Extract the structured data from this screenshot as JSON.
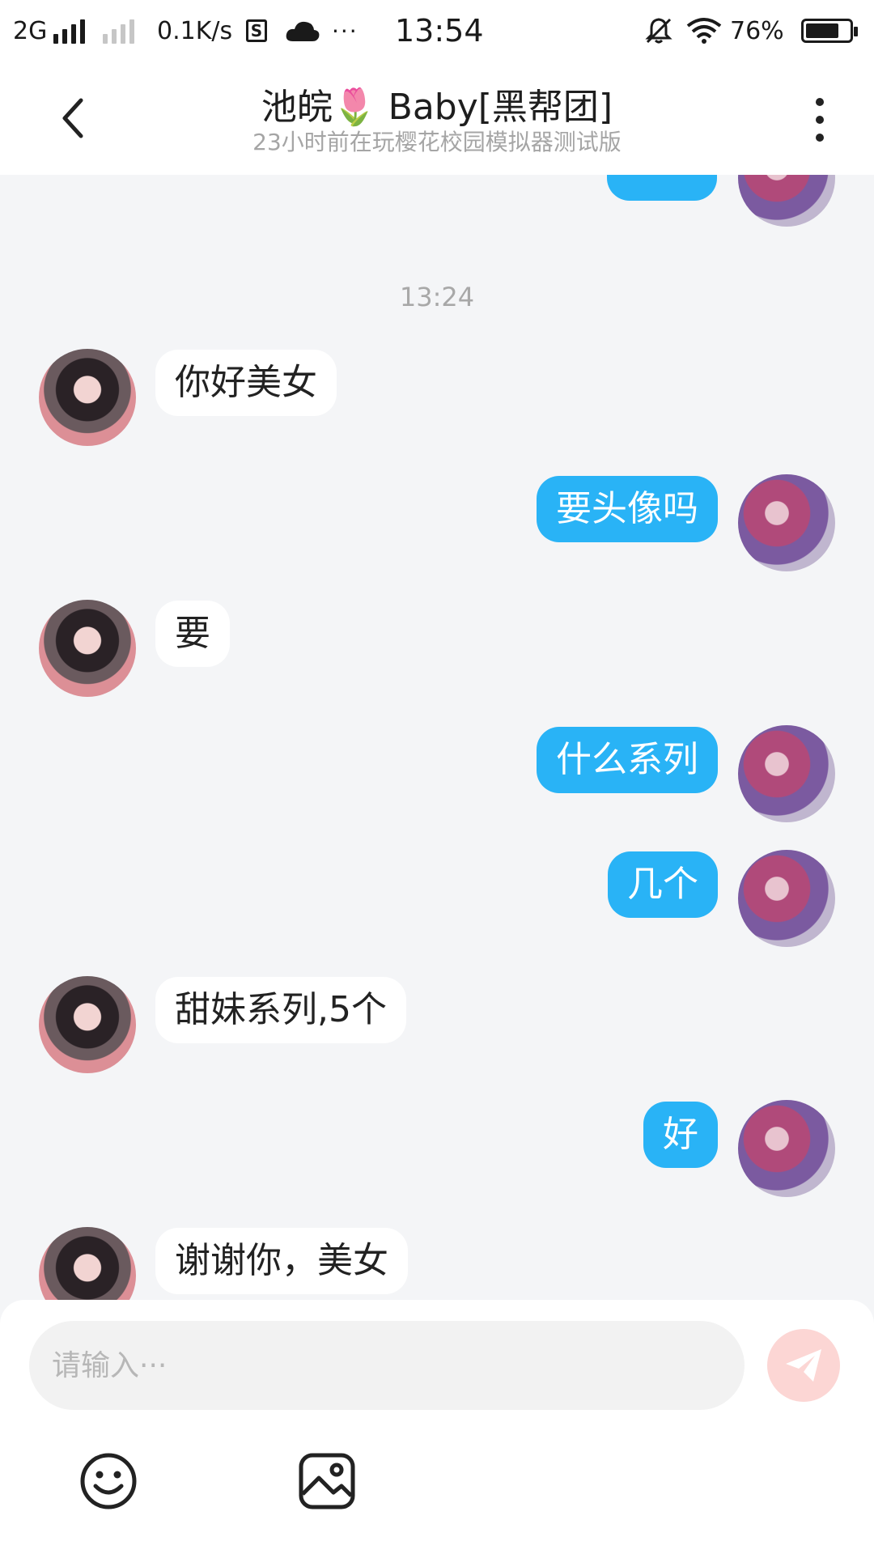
{
  "status_bar": {
    "network": "2G",
    "speed": "0.1K/s",
    "s_badge": "S",
    "more": "···",
    "time": "13:54",
    "battery": "76%",
    "battery_level": 0.76
  },
  "header": {
    "title": "池皖🌷 Baby[黑帮团]",
    "subtitle": "23小时前在玩樱花校园模拟器测试版"
  },
  "chat": {
    "timestamp": "13:24",
    "messages": [
      {
        "side": "in",
        "text": "你好美女"
      },
      {
        "side": "out",
        "text": "要头像吗"
      },
      {
        "side": "in",
        "text": "要"
      },
      {
        "side": "out",
        "text": "什么系列"
      },
      {
        "side": "out",
        "text": "几个"
      },
      {
        "side": "in",
        "text": "甜妹系列,5个"
      },
      {
        "side": "out",
        "text": "好"
      },
      {
        "side": "in",
        "text": "谢谢你，美女"
      }
    ]
  },
  "composer": {
    "placeholder": "请输入···",
    "send_icon": "paper-plane-icon",
    "tools": [
      "emoji-icon",
      "image-icon"
    ]
  },
  "colors": {
    "outgoing_bubble": "#29b3f6",
    "incoming_bubble": "#ffffff",
    "background": "#f4f5f7",
    "send_button": "#fcd6d4"
  }
}
